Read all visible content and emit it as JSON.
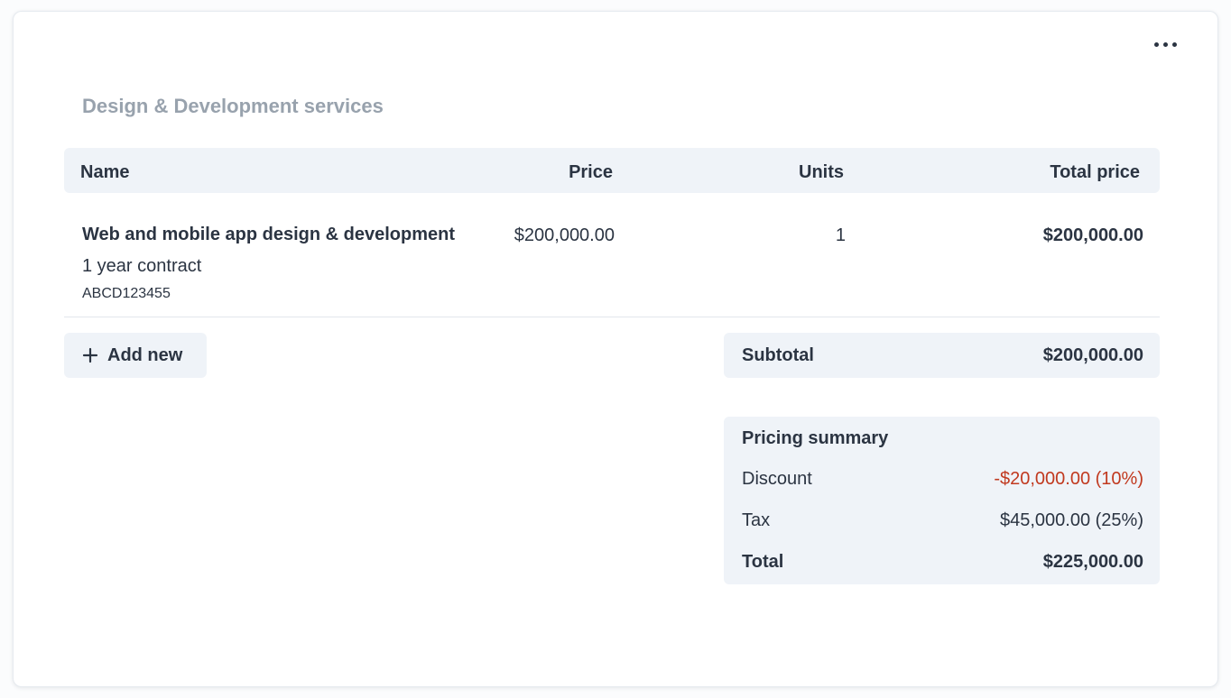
{
  "section": {
    "title": "Design & Development services"
  },
  "table": {
    "columns": {
      "name": "Name",
      "price": "Price",
      "units": "Units",
      "total": "Total price"
    },
    "rows": [
      {
        "name": "Web and mobile app design & development",
        "subtitle": "1 year contract",
        "sku": "ABCD123455",
        "price": "$200,000.00",
        "units": "1",
        "total": "$200,000.00"
      }
    ]
  },
  "actions": {
    "add_new_label": "Add new",
    "add_icon": "plus-icon",
    "more_icon": "more-horizontal-icon"
  },
  "subtotal": {
    "label": "Subtotal",
    "value": "$200,000.00"
  },
  "summary": {
    "heading": "Pricing summary",
    "discount_label": "Discount",
    "discount_value": "-$20,000.00 (10%)",
    "tax_label": "Tax",
    "tax_value": "$45,000.00 (25%)",
    "total_label": "Total",
    "total_value": "$225,000.00"
  },
  "colors": {
    "text": "#2b3442",
    "muted": "#98a2ad",
    "panel": "#eff3f8",
    "discount": "#c1391f"
  }
}
